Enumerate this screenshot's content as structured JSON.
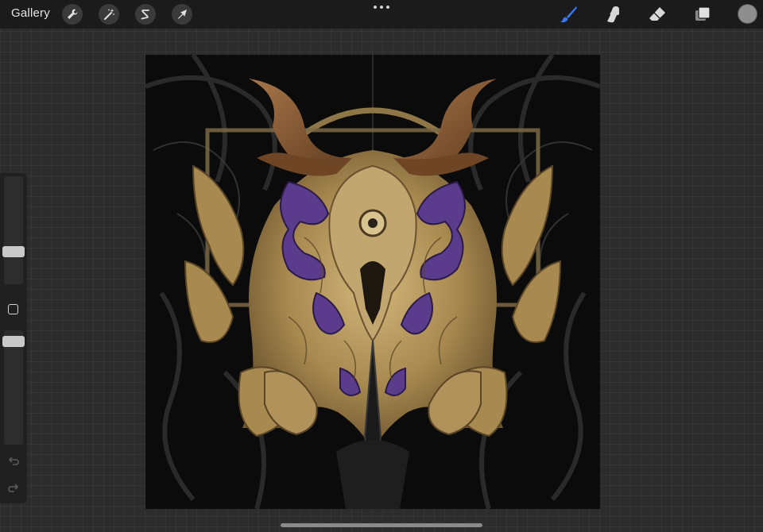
{
  "topbar": {
    "gallery_label": "Gallery",
    "left_tools": [
      {
        "name": "actions",
        "icon": "wrench-icon"
      },
      {
        "name": "adjustments",
        "icon": "magic-wand-icon"
      },
      {
        "name": "selection",
        "icon": "selection-s-icon"
      },
      {
        "name": "transform",
        "icon": "arrow-cursor-icon"
      }
    ],
    "more_menu_icon": "more-dots-icon",
    "right_tools": [
      {
        "name": "brush",
        "icon": "brush-icon",
        "active": true,
        "active_color": "#3478f6"
      },
      {
        "name": "smudge",
        "icon": "smudge-finger-icon",
        "active": false
      },
      {
        "name": "eraser",
        "icon": "eraser-icon",
        "active": false
      },
      {
        "name": "layers",
        "icon": "layers-icon",
        "active": false
      }
    ],
    "current_color": "#8e8e8e"
  },
  "sidebar": {
    "brush_size_level": 0.28,
    "brush_opacity_level": 0.9,
    "modify_icon": "square-icon",
    "undo_icon": "undo-arrow-icon",
    "redo_icon": "redo-arrow-icon"
  },
  "canvas": {
    "artwork_description_icon": "artwork-illustration",
    "palette": {
      "background": "#0b0b0b",
      "gold": "#a8894f",
      "gold_light": "#d2b77a",
      "horn": "#7a5230",
      "purple": "#5b3b8c",
      "dark_gray": "#2a2a2a"
    }
  }
}
